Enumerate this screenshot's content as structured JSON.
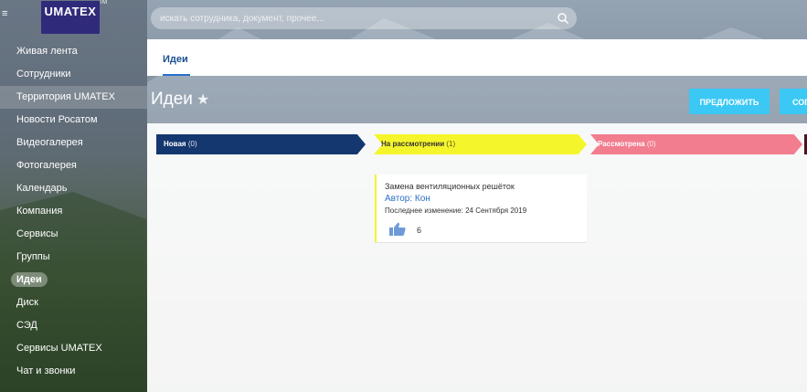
{
  "search": {
    "placeholder": "искать сотрудника, документ, прочее..."
  },
  "logo": {
    "text": "UMATEX",
    "tm": "TM"
  },
  "sidebar": {
    "items": [
      {
        "label": "Живая лента"
      },
      {
        "label": "Сотрудники"
      },
      {
        "label": "Территория UMATEX"
      },
      {
        "label": "Новости Росатом"
      },
      {
        "label": "Видеогалерея"
      },
      {
        "label": "Фотогалерея"
      },
      {
        "label": "Календарь"
      },
      {
        "label": "Компания"
      },
      {
        "label": "Сервисы"
      },
      {
        "label": "Группы"
      },
      {
        "label": "Идеи"
      },
      {
        "label": "Диск"
      },
      {
        "label": "СЭД"
      },
      {
        "label": "Сервисы UMATEX"
      },
      {
        "label": "Чат и звонки"
      }
    ]
  },
  "tabs": {
    "active": "Идеи"
  },
  "page": {
    "title": "Идеи",
    "star": "★"
  },
  "buttons": {
    "propose": "ПРЕДЛОЖИТЬ",
    "second": "СОГ"
  },
  "stages": [
    {
      "label": "Новая",
      "count": "(0)",
      "color": "#13376e"
    },
    {
      "label": "На рассмотрении",
      "count": "(1)",
      "color": "#f5f52b"
    },
    {
      "label": "Рассмотрена",
      "count": "(0)",
      "color": "#f27d8f"
    }
  ],
  "card": {
    "title": "Замена вентиляционных решёток",
    "author": "Автор: Кон",
    "changed": "Последнее изменение: 24 Сентября 2019",
    "likes": "6"
  }
}
